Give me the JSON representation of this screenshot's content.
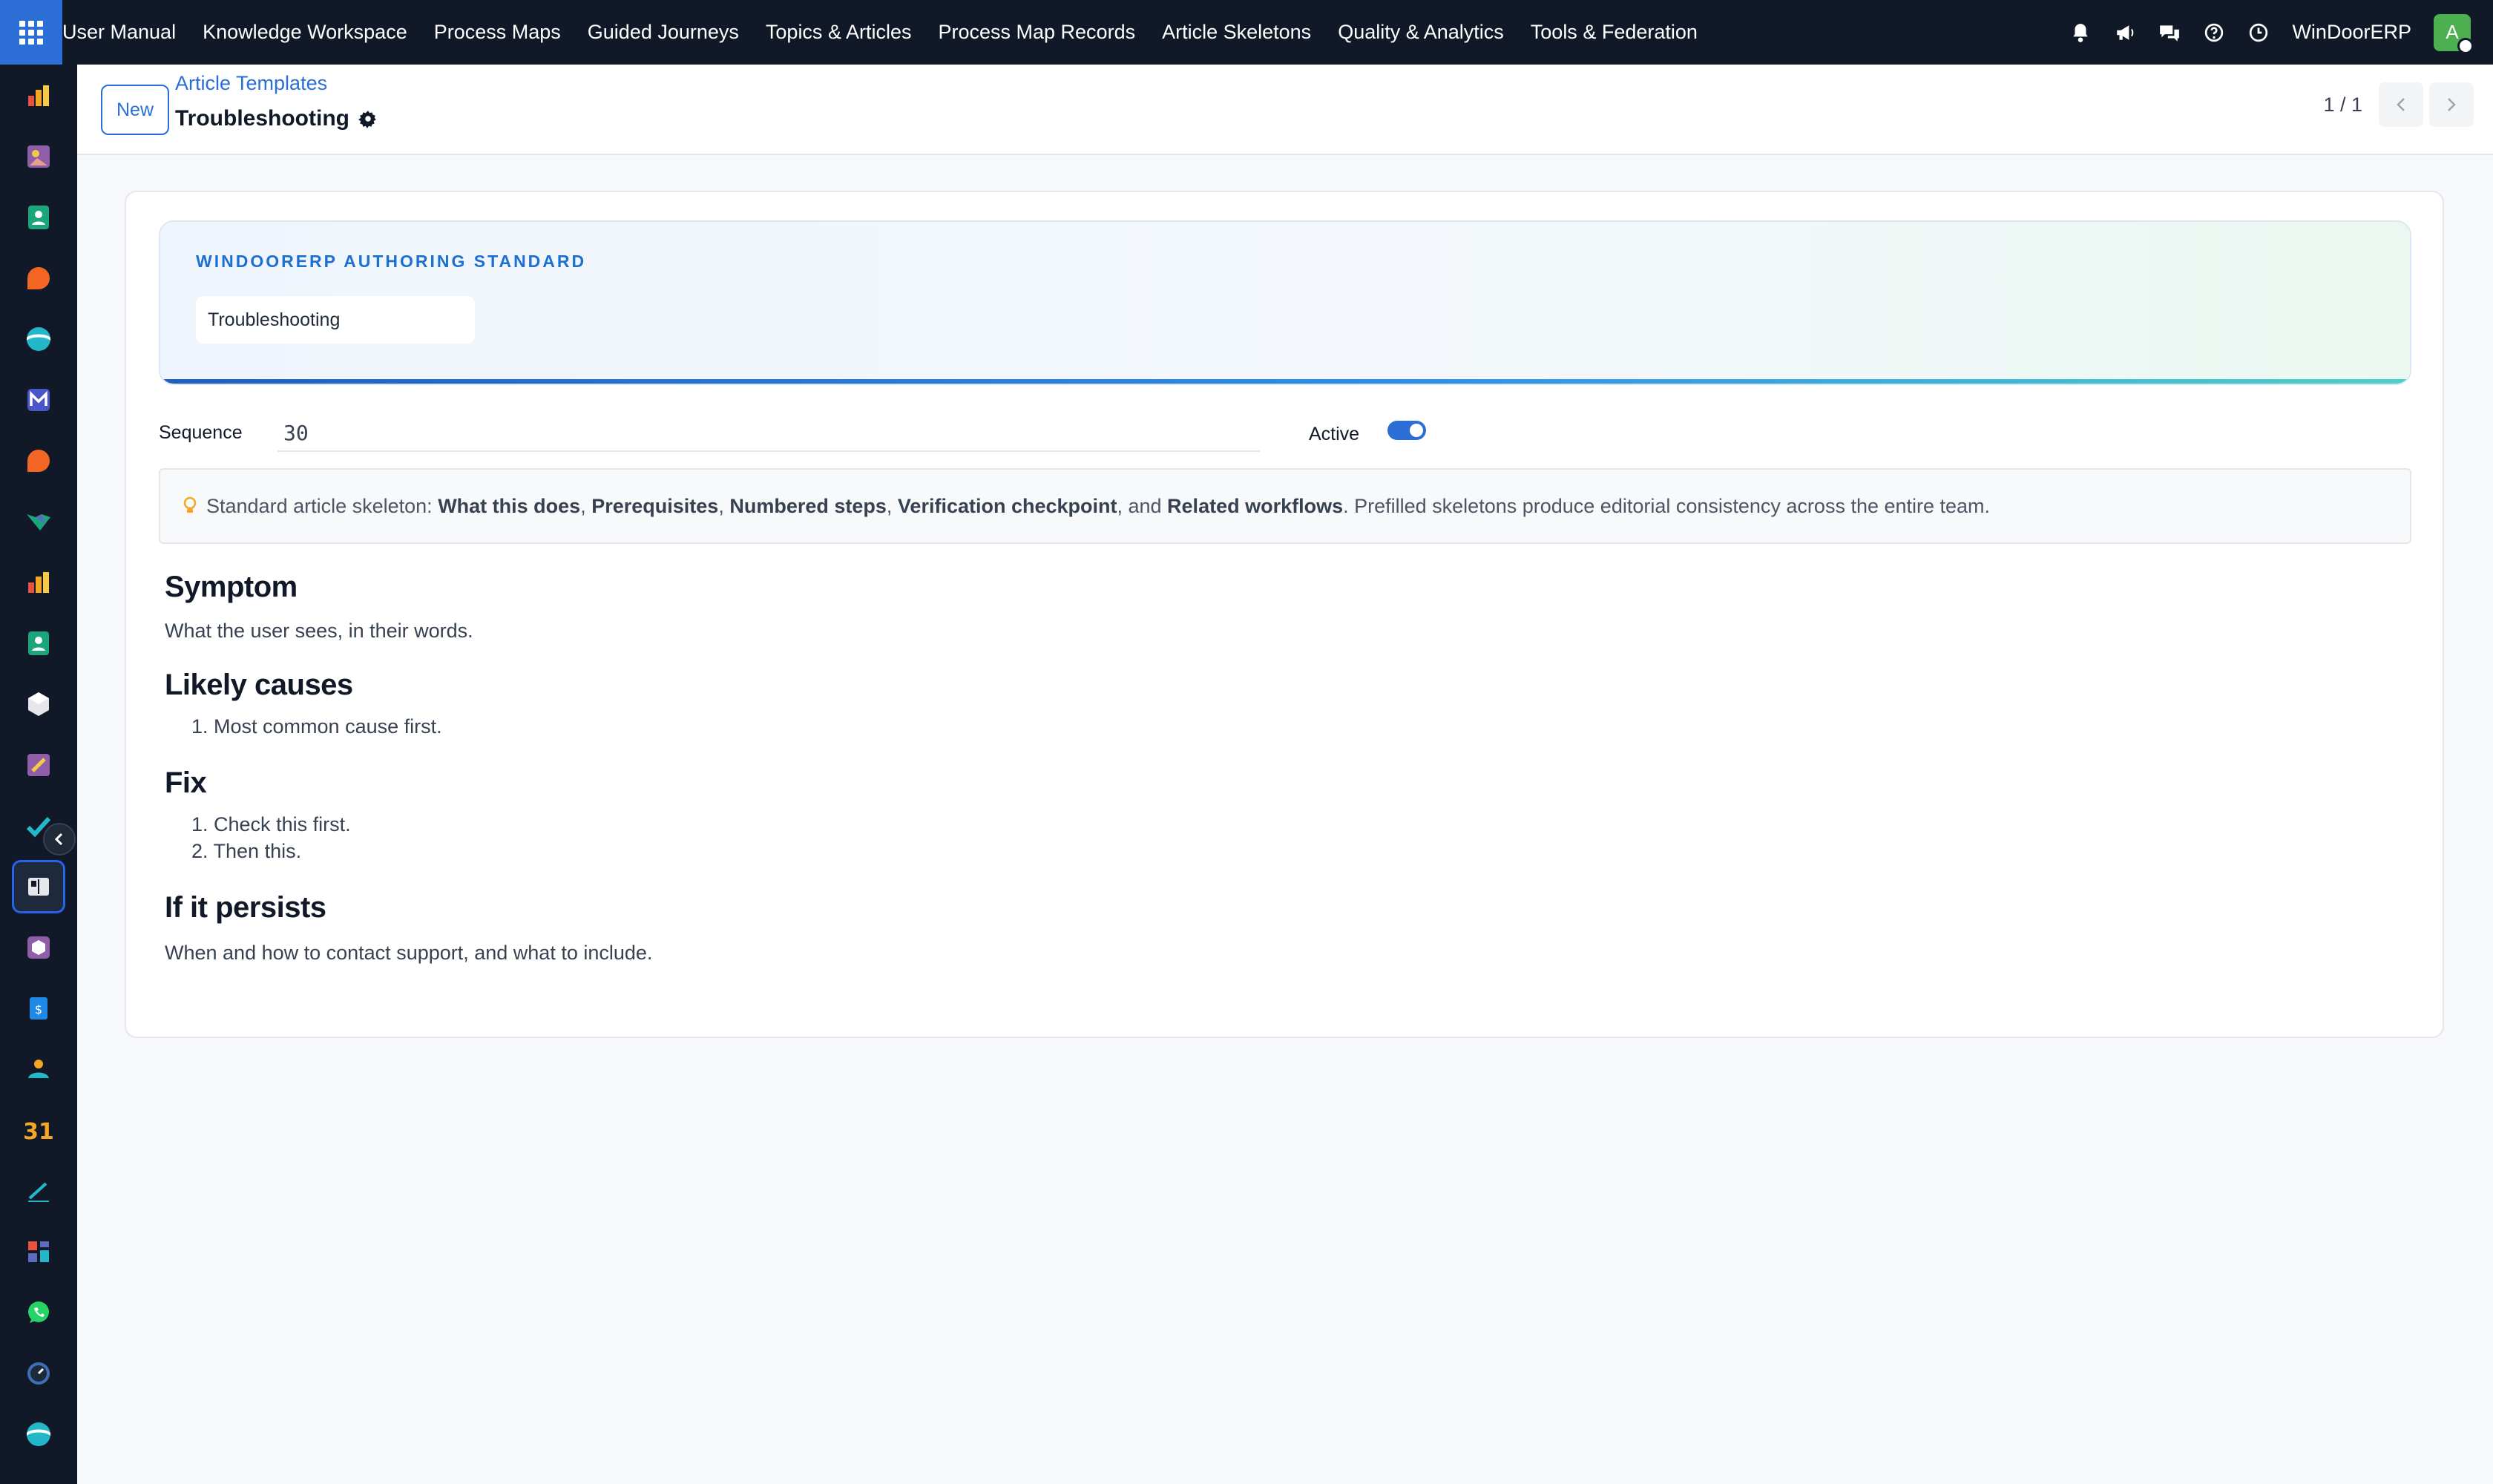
{
  "topbar": {
    "menu": [
      "User Manual",
      "Knowledge Workspace",
      "Process Maps",
      "Guided Journeys",
      "Topics & Articles",
      "Process Map Records",
      "Article Skeletons",
      "Quality & Analytics",
      "Tools & Federation"
    ],
    "company": "WinDoorERP",
    "avatar_initial": "A",
    "accent": "#2b6fd6",
    "icons": [
      "bell-icon",
      "megaphone-icon",
      "chat-icon",
      "help-icon",
      "clock-icon"
    ]
  },
  "sidebar": {
    "apps": [
      "chart-app",
      "photo-app",
      "contacts-app",
      "discuss-app",
      "helpdesk-app",
      "mail-app",
      "discuss-app",
      "map-app",
      "reports-app",
      "employees-app",
      "inventory-app",
      "studio-app",
      "project-app",
      "knowledge-app",
      "products-app",
      "accounting-app",
      "users-app",
      "calendar-app",
      "sign-app",
      "dashboard-app",
      "whatsapp-app",
      "timer-app",
      "helpdesk-app"
    ]
  },
  "control": {
    "new_label": "New",
    "breadcrumb": "Article Templates",
    "title": "Troubleshooting",
    "pager": "1 / 1"
  },
  "form": {
    "eyebrow": "WINDOORERP AUTHORING STANDARD",
    "name": "Troubleshooting",
    "sequence_label": "Sequence",
    "sequence_value": "30",
    "active_label": "Active",
    "active": true,
    "hint": {
      "prefix": "Standard article skeleton: ",
      "items": [
        "What this does",
        "Prerequisites",
        "Numbered steps",
        "Verification checkpoint",
        "Related workflows"
      ],
      "sep1": ", ",
      "sep_and": ", and ",
      "suffix": ". Prefilled skeletons produce editorial consistency across the entire team."
    },
    "body": {
      "symptom_h": "Symptom",
      "symptom_p": "What the user sees, in their words.",
      "causes_h": "Likely causes",
      "causes_items": [
        "Most common cause first."
      ],
      "fix_h": "Fix",
      "fix_items": [
        "Check this first.",
        "Then this."
      ],
      "persists_h": "If it persists",
      "persists_p": "When and how to contact support, and what to include."
    }
  }
}
